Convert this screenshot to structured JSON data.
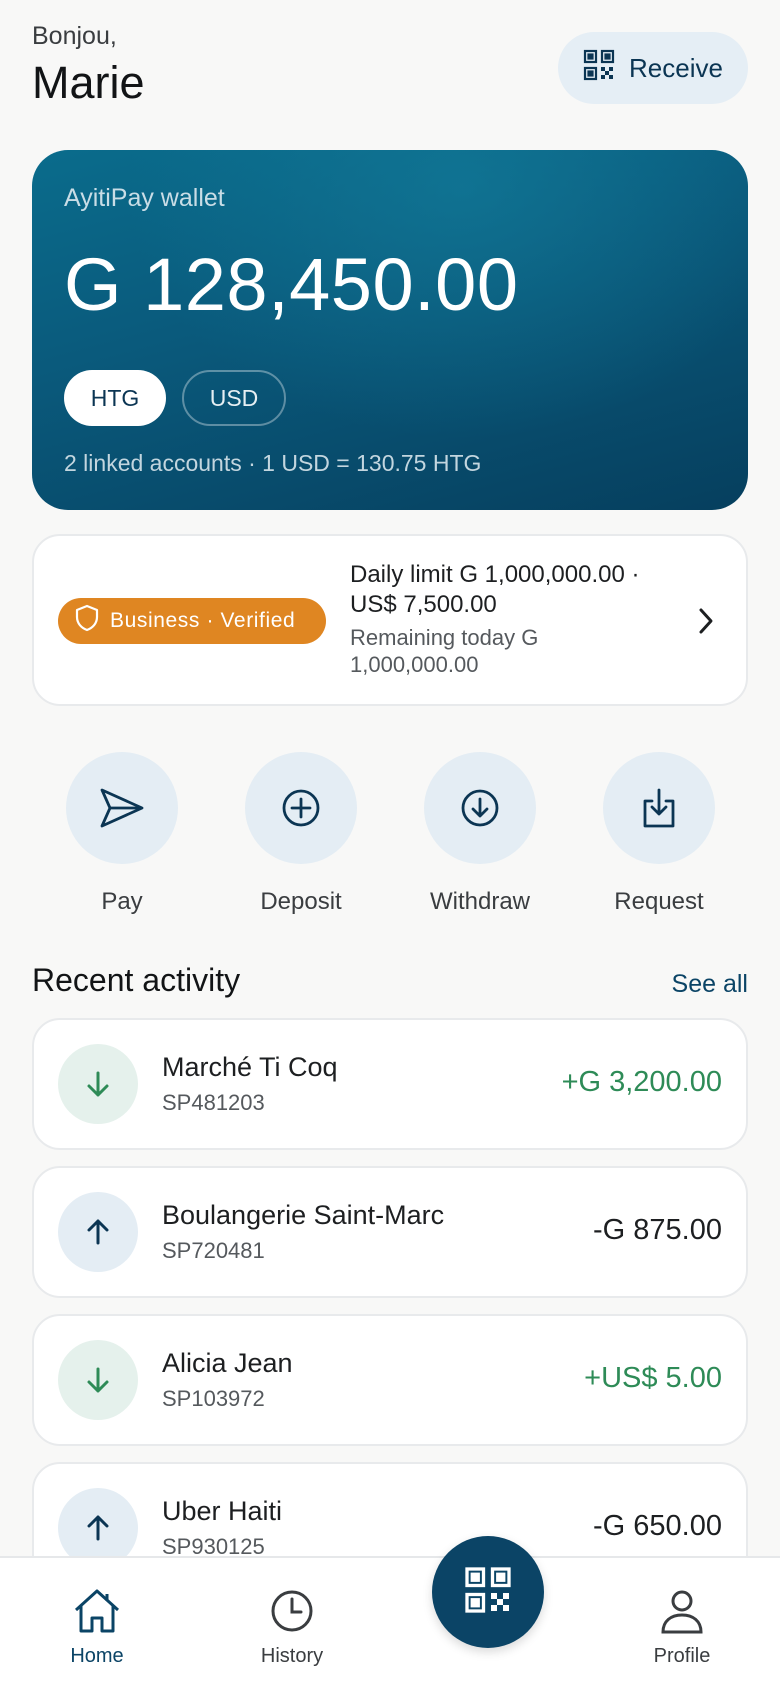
{
  "header": {
    "greeting": "Bonjou,",
    "name": "Marie",
    "receive_label": "Receive",
    "receive_icon": "qr-code-icon"
  },
  "wallet": {
    "label": "AyitiPay wallet",
    "balance": "G 128,450.00",
    "currencies": [
      "HTG",
      "USD"
    ],
    "selected_currency": "HTG",
    "footer": "2 linked accounts  ·  1 USD = 130.75 HTG"
  },
  "limits": {
    "badge": "Business · Verified",
    "badge_icon": "shield-icon",
    "daily_limit": "Daily limit G 1,000,000.00  ·  US$ 7,500.00",
    "remaining": "Remaining today G 1,000,000.00"
  },
  "actions": [
    {
      "label": "Pay",
      "icon": "send-icon"
    },
    {
      "label": "Deposit",
      "icon": "plus-circle-icon"
    },
    {
      "label": "Withdraw",
      "icon": "arrow-down-circle-icon"
    },
    {
      "label": "Request",
      "icon": "download-box-icon"
    }
  ],
  "activity": {
    "title": "Recent activity",
    "see_all": "See all",
    "items": [
      {
        "name": "Marché Ti Coq",
        "ref": "SP481203",
        "amount": "+G 3,200.00",
        "direction": "in"
      },
      {
        "name": "Boulangerie Saint-Marc",
        "ref": "SP720481",
        "amount": "-G 875.00",
        "direction": "out"
      },
      {
        "name": "Alicia Jean",
        "ref": "SP103972",
        "amount": "+US$ 5.00",
        "direction": "in"
      },
      {
        "name": "Uber Haiti",
        "ref": "SP930125",
        "amount": "-G 650.00",
        "direction": "out"
      }
    ]
  },
  "nav": {
    "home": "Home",
    "history": "History",
    "profile": "Profile",
    "active": "Home"
  },
  "colors": {
    "brand": "#0b4466",
    "accent_orange": "#df8622",
    "positive": "#2e8b57"
  }
}
